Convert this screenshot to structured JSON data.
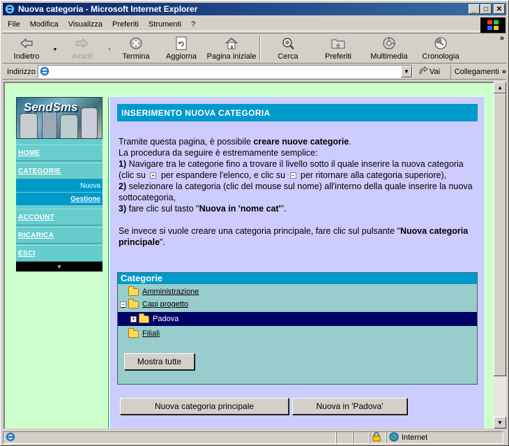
{
  "window": {
    "title": "Nuova categoria - Microsoft Internet Explorer"
  },
  "menu": [
    "File",
    "Modifica",
    "Visualizza",
    "Preferiti",
    "Strumenti",
    "?"
  ],
  "toolbar": {
    "back": "Indietro",
    "forward": "Avanti",
    "stop": "Termina",
    "refresh": "Aggiorna",
    "home": "Pagina iniziale",
    "search": "Cerca",
    "favorites": "Preferiti",
    "media": "Multimedia",
    "history": "Cronologia"
  },
  "address": {
    "label": "Indirizzo",
    "value": "",
    "go": "Vai",
    "links": "Collegamenti"
  },
  "sidebar": {
    "logo_text": "SendSms",
    "items": [
      {
        "label": "HOME"
      },
      {
        "label": "CATEGORIE"
      },
      {
        "label": "Nuova"
      },
      {
        "label": "Gestione"
      },
      {
        "label": "ACCOUNT"
      },
      {
        "label": "RICARICA"
      },
      {
        "label": "ESCI"
      }
    ]
  },
  "main": {
    "header": "INSERIMENTO NUOVA CATEGORIA",
    "p1_a": "Tramite questa pagina, è possibile ",
    "p1_b": "creare nuove categorie",
    "p1_c": ".",
    "p2": "La procedura da seguire è estremamente semplice:",
    "s1_num": "1)",
    "s1_a": " Navigare tra le categorie fino a trovare il livello sotto il quale inserire la nuova categoria (clic su ",
    "s1_b": " per espandere l'elenco, e clic su ",
    "s1_c": " per ritornare alla categoria superiore),",
    "s2_num": "2)",
    "s2": " selezionare la categoria (clic del mouse sul nome) all'interno della quale inserire la nuova sottocategoria,",
    "s3_num": "3)",
    "s3_a": " fare clic sul tasto \"",
    "s3_b": "Nuova in 'nome cat'",
    "s3_c": "\".",
    "p3_a": "Se invece si vuole creare una categoria principale, fare clic sul pulsante \"",
    "p3_b": "Nuova categoria principale",
    "p3_c": "\"."
  },
  "categories": {
    "title": "Categorie",
    "nodes": [
      {
        "label": "Amministrazione"
      },
      {
        "label": "Capi progetto"
      },
      {
        "label": "Padova"
      },
      {
        "label": "Filiali"
      }
    ],
    "show_all": "Mostra tutte"
  },
  "buttons": {
    "new_main": "Nuova categoria principale",
    "new_in": "Nuova in 'Padova'"
  },
  "status": {
    "zone": "Internet"
  }
}
